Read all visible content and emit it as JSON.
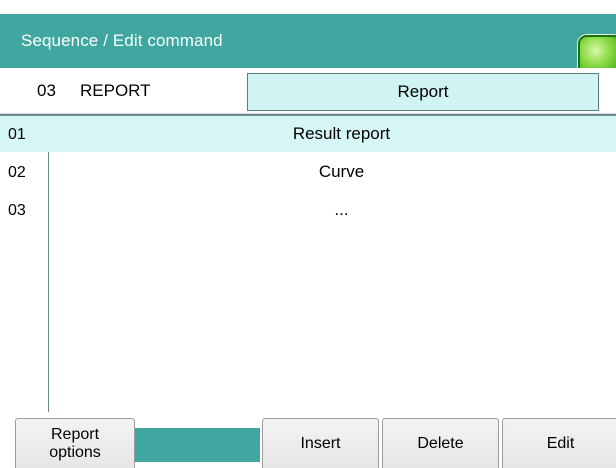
{
  "title": "Sequence / Edit command",
  "command": {
    "number": "03",
    "name": "REPORT",
    "type": "Report"
  },
  "list": [
    {
      "index": "01",
      "text": "Result report",
      "selected": true
    },
    {
      "index": "02",
      "text": "Curve",
      "selected": false
    },
    {
      "index": "03",
      "text": "...",
      "selected": false
    }
  ],
  "function_keys": {
    "report_options": "Report\noptions",
    "insert": "Insert",
    "delete": "Delete",
    "edit": "Edit"
  },
  "colors": {
    "accent": "#3fa7a0",
    "selection": "#d6f6f6",
    "status_led": "#4fb81e"
  }
}
